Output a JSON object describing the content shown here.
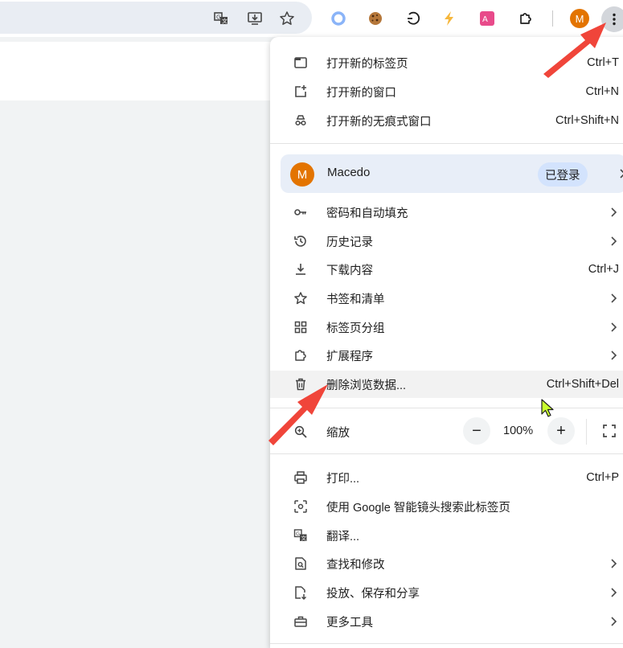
{
  "toolbar": {
    "icons": [
      "translate-icon",
      "install-app-icon",
      "bookmark-star-icon",
      "extension-circle-icon",
      "cookie-extension-icon",
      "timer-extension-icon",
      "lightning-extension-icon",
      "pink-translate-extension-icon",
      "extensions-puzzle-icon"
    ],
    "avatar_letter": "M"
  },
  "menu": {
    "new_tab": {
      "label": "打开新的标签页",
      "shortcut": "Ctrl+T"
    },
    "new_window": {
      "label": "打开新的窗口",
      "shortcut": "Ctrl+N"
    },
    "incognito": {
      "label": "打开新的无痕式窗口",
      "shortcut": "Ctrl+Shift+N"
    },
    "profile": {
      "avatar_letter": "M",
      "name": "Macedo",
      "status": "已登录"
    },
    "passwords": {
      "label": "密码和自动填充"
    },
    "history": {
      "label": "历史记录"
    },
    "downloads": {
      "label": "下载内容",
      "shortcut": "Ctrl+J"
    },
    "bookmarks": {
      "label": "书签和清单"
    },
    "tab_groups": {
      "label": "标签页分组"
    },
    "extensions": {
      "label": "扩展程序"
    },
    "clear_data": {
      "label": "删除浏览数据...",
      "shortcut": "Ctrl+Shift+Del"
    },
    "zoom": {
      "label": "缩放",
      "minus": "−",
      "value": "100%",
      "plus": "+"
    },
    "print": {
      "label": "打印...",
      "shortcut": "Ctrl+P"
    },
    "lens": {
      "label": "使用 Google 智能镜头搜索此标签页"
    },
    "translate": {
      "label": "翻译..."
    },
    "find_edit": {
      "label": "查找和修改"
    },
    "cast_save_share": {
      "label": "投放、保存和分享"
    },
    "more_tools": {
      "label": "更多工具"
    }
  },
  "colors": {
    "accent": "#e37400",
    "annotation_arrow": "#f0453a",
    "profile_bg": "#e8eef8"
  }
}
